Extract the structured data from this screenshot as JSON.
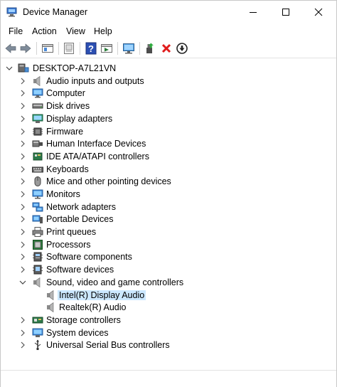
{
  "window": {
    "title": "Device Manager"
  },
  "menu": {
    "items": [
      "File",
      "Action",
      "View",
      "Help"
    ]
  },
  "toolbar": {
    "buttons": [
      "back-arrow-icon",
      "forward-arrow-icon",
      "properties-icon",
      "update-list-icon",
      "help-icon",
      "console-view-icon",
      "monitor-scan-icon",
      "add-driver-icon",
      "uninstall-x-icon",
      "download-driver-icon"
    ]
  },
  "tree": {
    "root": "DESKTOP-A7L21VN",
    "categories": [
      {
        "label": "Audio inputs and outputs",
        "icon": "speaker-icon",
        "expanded": false
      },
      {
        "label": "Computer",
        "icon": "computer-icon",
        "expanded": false
      },
      {
        "label": "Disk drives",
        "icon": "disk-drive-icon",
        "expanded": false
      },
      {
        "label": "Display adapters",
        "icon": "display-adapter-icon",
        "expanded": false
      },
      {
        "label": "Firmware",
        "icon": "firmware-chip-icon",
        "expanded": false
      },
      {
        "label": "Human Interface Devices",
        "icon": "hid-icon",
        "expanded": false
      },
      {
        "label": "IDE ATA/ATAPI controllers",
        "icon": "ide-controller-icon",
        "expanded": false
      },
      {
        "label": "Keyboards",
        "icon": "keyboard-icon",
        "expanded": false
      },
      {
        "label": "Mice and other pointing devices",
        "icon": "mouse-icon",
        "expanded": false
      },
      {
        "label": "Monitors",
        "icon": "monitor-icon",
        "expanded": false
      },
      {
        "label": "Network adapters",
        "icon": "network-adapter-icon",
        "expanded": false
      },
      {
        "label": "Portable Devices",
        "icon": "portable-device-icon",
        "expanded": false
      },
      {
        "label": "Print queues",
        "icon": "printer-icon",
        "expanded": false
      },
      {
        "label": "Processors",
        "icon": "processor-icon",
        "expanded": false
      },
      {
        "label": "Software components",
        "icon": "software-component-icon",
        "expanded": false
      },
      {
        "label": "Software devices",
        "icon": "software-device-icon",
        "expanded": false
      },
      {
        "label": "Sound, video and game controllers",
        "icon": "speaker-icon",
        "expanded": true,
        "children": [
          {
            "label": "Intel(R) Display Audio",
            "icon": "speaker-icon",
            "selected": true
          },
          {
            "label": "Realtek(R) Audio",
            "icon": "speaker-icon",
            "selected": false
          }
        ]
      },
      {
        "label": "Storage controllers",
        "icon": "storage-controller-icon",
        "expanded": false
      },
      {
        "label": "System devices",
        "icon": "system-device-icon",
        "expanded": false
      },
      {
        "label": "Universal Serial Bus controllers",
        "icon": "usb-icon",
        "expanded": false
      }
    ]
  },
  "colors": {
    "selection": "#cce8ff",
    "accent": "#0078d7"
  }
}
